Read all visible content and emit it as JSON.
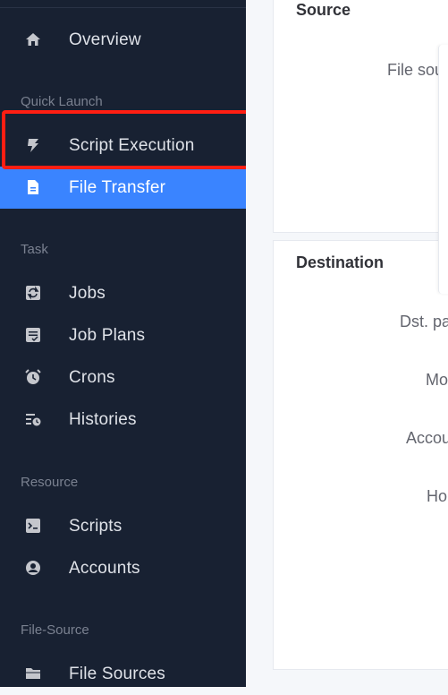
{
  "sidebar": {
    "items": [
      {
        "label": "Overview",
        "icon": "home-icon"
      },
      {
        "label": "Script Execution",
        "icon": "lightning-icon"
      },
      {
        "label": "File Transfer",
        "icon": "file-icon"
      },
      {
        "label": "Jobs",
        "icon": "refresh-icon"
      },
      {
        "label": "Job Plans",
        "icon": "checklist-icon"
      },
      {
        "label": "Crons",
        "icon": "alarm-clock-icon"
      },
      {
        "label": "Histories",
        "icon": "history-list-icon"
      },
      {
        "label": "Scripts",
        "icon": "terminal-icon"
      },
      {
        "label": "Accounts",
        "icon": "user-circle-icon"
      },
      {
        "label": "File Sources",
        "icon": "folder-icon"
      }
    ],
    "groups": {
      "quick_launch": "Quick Launch",
      "task": "Task",
      "resource": "Resource",
      "file_source": "File-Source"
    },
    "active_item": "File Transfer"
  },
  "main": {
    "source": {
      "title": "Source",
      "file_source_label": "File sou"
    },
    "destination": {
      "title": "Destination",
      "dst_path_label": "Dst. pa",
      "mode_label": "Mo",
      "account_label": "Accou",
      "host_label": "Ho"
    }
  },
  "colors": {
    "sidebar_bg": "#182132",
    "active_bg": "#3a84ff",
    "highlight": "#ff1e12"
  }
}
